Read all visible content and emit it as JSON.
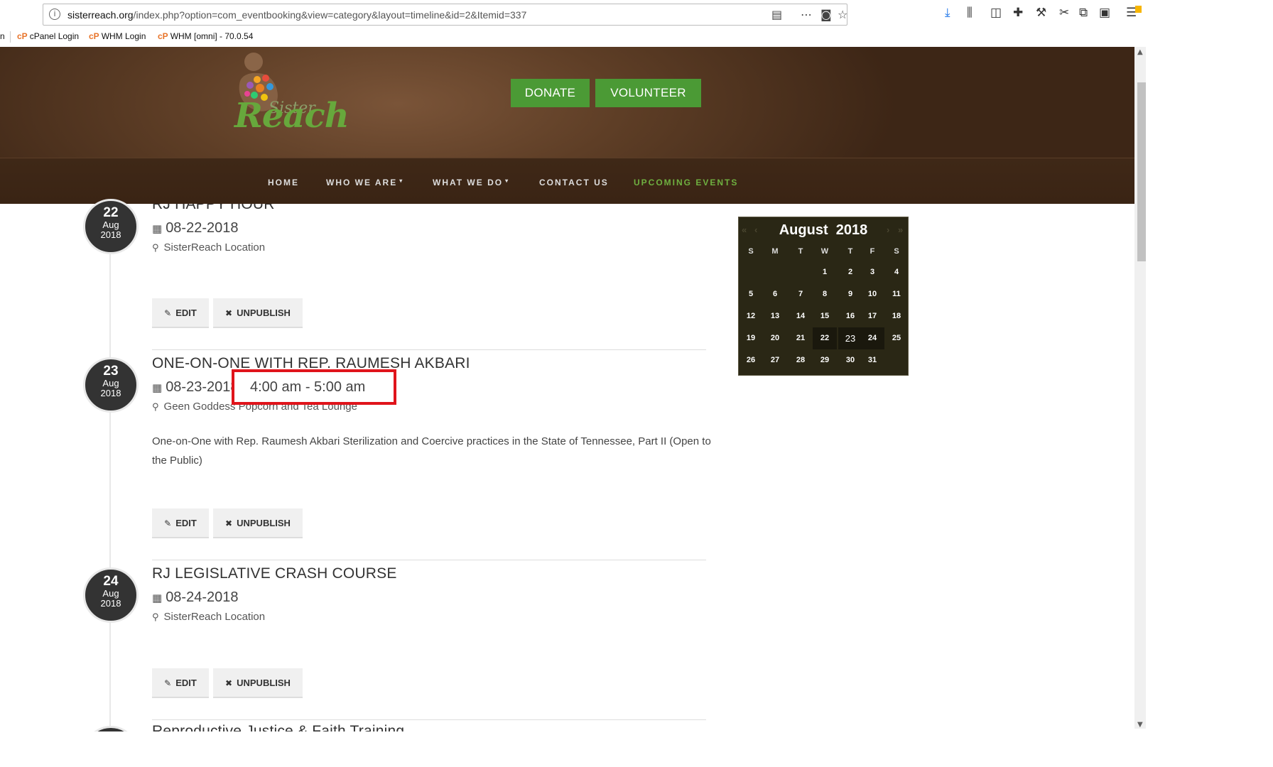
{
  "browser": {
    "url_domain": "sisterreach.org",
    "url_path": "/index.php?option=com_eventbooking&view=category&layout=timeline&id=2&Itemid=337",
    "info_icon": "i",
    "bookmarks": [
      {
        "label": "n"
      },
      {
        "label": "cPanel Login"
      },
      {
        "label": "WHM Login"
      },
      {
        "label": "WHM [omni] - 70.0.54"
      }
    ]
  },
  "site": {
    "logo_main": "Reach",
    "logo_script": "Sister",
    "donate_label": "DONATE",
    "volunteer_label": "VOLUNTEER",
    "nav": [
      {
        "label": "HOME"
      },
      {
        "label": "WHO WE ARE"
      },
      {
        "label": "WHAT WE DO"
      },
      {
        "label": "CONTACT US"
      },
      {
        "label": "UPCOMING EVENTS"
      }
    ],
    "brand_green": "#4b9a35",
    "header_brown": "#5e3e26"
  },
  "events": [
    {
      "day": "22",
      "month": "Aug",
      "year": "2018",
      "title": "RJ HAPPY HOUR",
      "date": "08-22-2018",
      "location": "SisterReach Location",
      "edit_label": "EDIT",
      "unpublish_label": "UNPUBLISH"
    },
    {
      "day": "23",
      "month": "Aug",
      "year": "2018",
      "title": "ONE-ON-ONE WITH REP. RAUMESH AKBARI",
      "date": "08-23-2018",
      "time": "4:00 am - 5:00 am",
      "location": "Geen Goddess Popcorn and Tea Lounge",
      "description": "One-on-One with Rep. Raumesh Akbari Sterilization and Coercive practices in the State of Tennessee, Part II (Open to the Public)",
      "edit_label": "EDIT",
      "unpublish_label": "UNPUBLISH"
    },
    {
      "day": "24",
      "month": "Aug",
      "year": "2018",
      "title": "RJ LEGISLATIVE CRASH COURSE",
      "date": "08-24-2018",
      "location": "SisterReach Location",
      "edit_label": "EDIT",
      "unpublish_label": "UNPUBLISH"
    },
    {
      "title": "Reproductive Justice & Faith Training"
    }
  ],
  "calendar": {
    "month": "August",
    "year": "2018",
    "prev_year": "«",
    "prev_month": "‹",
    "next_month": "›",
    "next_year": "»",
    "weekdays": [
      "S",
      "M",
      "T",
      "W",
      "T",
      "F",
      "S"
    ],
    "weeks": [
      [
        "",
        "",
        "",
        "1",
        "2",
        "3",
        "4"
      ],
      [
        "5",
        "6",
        "7",
        "8",
        "9",
        "10",
        "11"
      ],
      [
        "12",
        "13",
        "14",
        "15",
        "16",
        "17",
        "18"
      ],
      [
        "19",
        "20",
        "21",
        "22",
        "23",
        "24",
        "25"
      ],
      [
        "26",
        "27",
        "28",
        "29",
        "30",
        "31",
        ""
      ]
    ]
  }
}
